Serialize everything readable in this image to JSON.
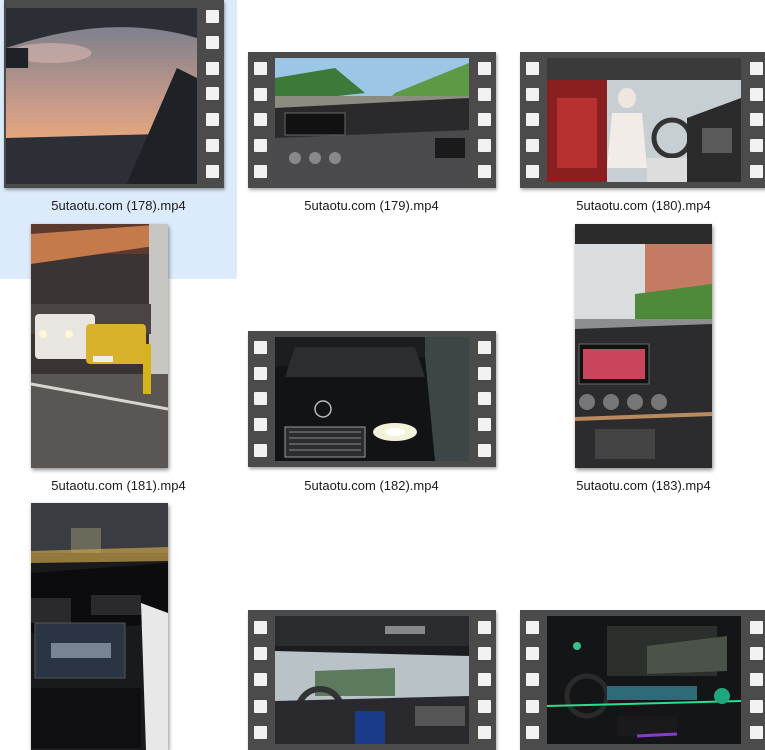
{
  "files": [
    {
      "name": "5utaotu.com (178).mp4",
      "selected": true,
      "scene": "sunset-windshield-icon"
    },
    {
      "name": "5utaotu.com (179).mp4",
      "selected": false,
      "scene": "highway-dashboard-icon"
    },
    {
      "name": "5utaotu.com (180).mp4",
      "selected": false,
      "scene": "driver-red-interior-icon"
    },
    {
      "name": "5utaotu.com (181).mp4",
      "selected": false,
      "scene": "parking-garage-icon"
    },
    {
      "name": "5utaotu.com (182).mp4",
      "selected": false,
      "scene": "mercedes-front-night-icon"
    },
    {
      "name": "5utaotu.com (183).mp4",
      "selected": false,
      "scene": "dashboard-screen-icon"
    },
    {
      "name": "",
      "selected": false,
      "scene": "city-night-interior-icon"
    },
    {
      "name": "",
      "selected": false,
      "scene": "rainy-cockpit-icon"
    },
    {
      "name": "",
      "selected": false,
      "scene": "ambient-light-interior-icon"
    }
  ]
}
